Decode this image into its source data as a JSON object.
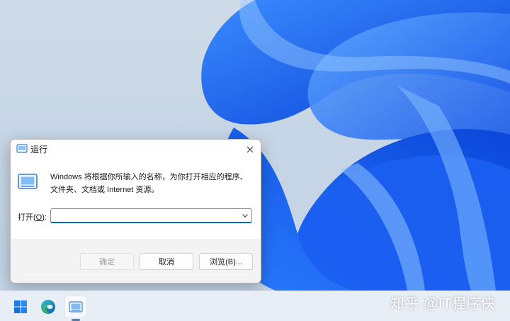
{
  "colors": {
    "accent": "#0067c0",
    "wallpaper_blue": "#1a6ff0",
    "taskbar_bg": "#e8eef6"
  },
  "run_dialog": {
    "title": "运行",
    "close_icon": "close-icon",
    "app_icon": "run-app-icon",
    "description": "Windows 将根据你所输入的名称，为你打开相应的程序、文件夹、文档或 Internet 资源。",
    "open_label_prefix": "打开(",
    "open_label_accesskey": "O",
    "open_label_suffix": "):",
    "open_value": "",
    "buttons": {
      "ok": "确定",
      "cancel": "取消",
      "browse": "浏览(B)..."
    }
  },
  "taskbar": {
    "items": [
      {
        "name": "start-icon"
      },
      {
        "name": "edge-icon"
      },
      {
        "name": "run-taskbar-icon",
        "active": true
      }
    ]
  },
  "watermark": "知乎 @IT程序侠"
}
